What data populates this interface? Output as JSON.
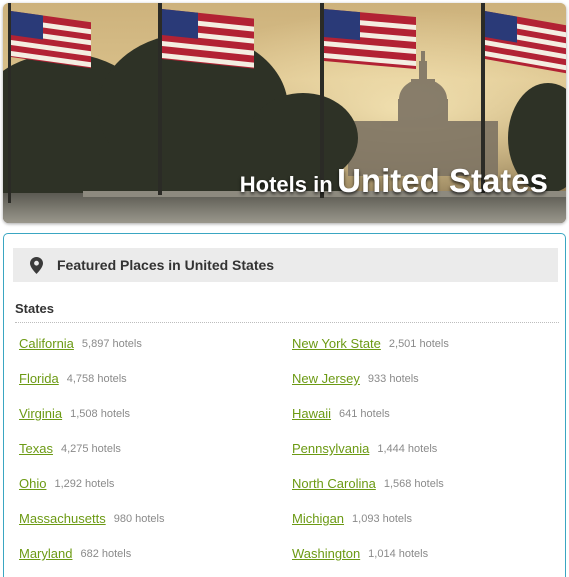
{
  "hero": {
    "title_prefix": "Hotels in",
    "title_country": "United States"
  },
  "featured": {
    "icon": "map-pin-icon",
    "title": "Featured Places in United States"
  },
  "states_heading": "States",
  "colors": {
    "link": "#6c9a14",
    "panel_border": "#3aa6c2",
    "bar_bg": "#ebebeb"
  },
  "states_left": [
    {
      "name": "California",
      "count": "5,897 hotels"
    },
    {
      "name": "Florida",
      "count": "4,758 hotels"
    },
    {
      "name": "Virginia",
      "count": "1,508 hotels"
    },
    {
      "name": "Texas",
      "count": "4,275 hotels"
    },
    {
      "name": "Ohio",
      "count": "1,292 hotels"
    },
    {
      "name": "Massachusetts",
      "count": "980 hotels"
    },
    {
      "name": "Maryland",
      "count": "682 hotels"
    }
  ],
  "states_right": [
    {
      "name": "New York State",
      "count": "2,501 hotels"
    },
    {
      "name": "New Jersey",
      "count": "933 hotels"
    },
    {
      "name": "Hawaii",
      "count": "641 hotels"
    },
    {
      "name": "Pennsylvania",
      "count": "1,444 hotels"
    },
    {
      "name": "North Carolina",
      "count": "1,568 hotels"
    },
    {
      "name": "Michigan",
      "count": "1,093 hotels"
    },
    {
      "name": "Washington",
      "count": "1,014 hotels"
    }
  ]
}
